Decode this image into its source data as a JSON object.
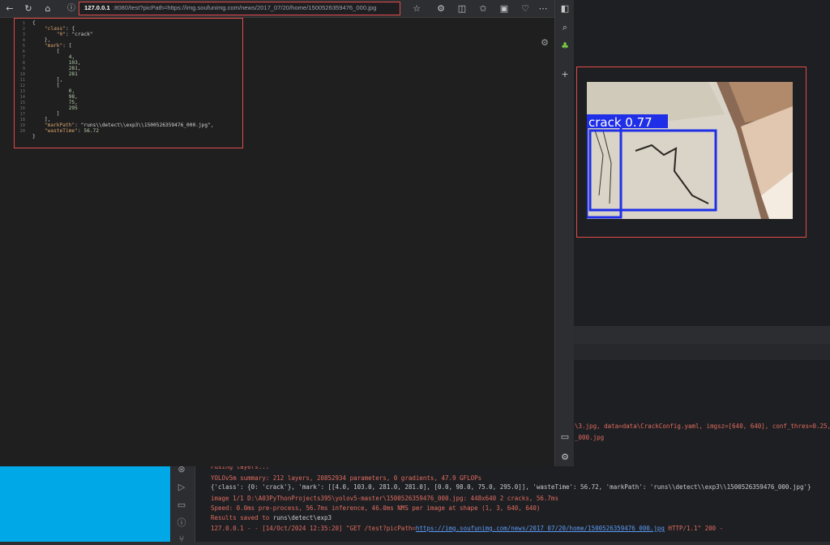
{
  "browser": {
    "url_host": "127.0.0.1",
    "url_path": ":8080/test?picPath=https://img.soufunimg.com/news/2017_07/20/home/1500526359476_000.jpg",
    "icons": [
      "back-icon",
      "refresh-icon",
      "home-icon",
      "info-icon",
      "star-icon",
      "extensions-icon",
      "split-screen-icon",
      "favorites-icon",
      "collections-icon",
      "performance-icon"
    ]
  },
  "json_view": {
    "line_numbers": [
      "1",
      "2",
      "3",
      "4",
      "5",
      "6",
      "7",
      "8",
      "9",
      "10",
      "11",
      "12",
      "13",
      "14",
      "15",
      "16",
      "17",
      "18",
      "19",
      "20"
    ],
    "lines": [
      "{",
      "    \"class\": {",
      "        \"0\": \"crack\"",
      "    },",
      "    \"mark\": [",
      "        [",
      "            4,",
      "            103,",
      "            281,",
      "            281",
      "        ],",
      "        [",
      "            0,",
      "            98,",
      "            75,",
      "            295",
      "        ]",
      "    ],",
      "    \"markPath\": \"runs\\\\detect\\\\exp3\\\\1500526359476_000.jpg\",",
      "    \"wasteTime\": 56.72",
      "}"
    ]
  },
  "preview": {
    "label": "crack 0.77"
  },
  "console": {
    "partial_line_1": "\\3.jpg, data=data\\CrackConfig.yaml, imgsz=[640, 640], conf_thres=0.25,",
    "partial_line_2": "_000.jpg",
    "fusing": "Fusing layers...",
    "summary": "YOLOv5m summary: 212 layers, 20852934 parameters, 0 gradients, 47.9 GFLOPs",
    "result_dict": "{'class': {0: 'crack'}, 'mark': [[4.0, 103.0, 281.0, 281.0], [0.0, 98.0, 75.0, 295.0]], 'wasteTime': 56.72, 'markPath': 'runs\\\\detect\\\\exp3\\\\1500526359476_000.jpg'}",
    "image_line": "image 1/1 D:\\A03PyThonProjects395\\yolov5-master\\1500526359476_000.jpg: 448x640 2 cracks, 56.7ms",
    "speed": "Speed: 0.0ms pre-process, 56.7ms inference, 46.0ms NMS per image at shape (1, 3, 640, 640)",
    "saved_prefix": "Results saved to ",
    "saved_path": "runs\\detect\\exp3",
    "request_prefix": "127.0.0.1 - - [14/Oct/2024 12:35:20] \"GET /test?picPath=",
    "request_link": "https://img.soufunimg.com/news/2017_07/20/home/1500526359476_000.jpg",
    "request_suffix": " HTTP/1.1\" 200 -"
  }
}
